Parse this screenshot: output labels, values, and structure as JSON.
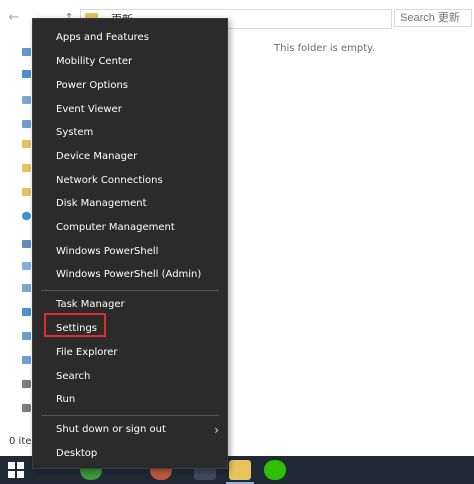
{
  "explorer": {
    "address_text": "更新",
    "search_placeholder": "Search 更新",
    "empty_message": "This folder is empty.",
    "status": "0 iter"
  },
  "menu": {
    "items": [
      {
        "label": "Apps and Features"
      },
      {
        "label": "Mobility Center"
      },
      {
        "label": "Power Options"
      },
      {
        "label": "Event Viewer"
      },
      {
        "label": "System"
      },
      {
        "label": "Device Manager"
      },
      {
        "label": "Network Connections"
      },
      {
        "label": "Disk Management"
      },
      {
        "label": "Computer Management"
      },
      {
        "label": "Windows PowerShell"
      },
      {
        "label": "Windows PowerShell (Admin)"
      },
      {
        "label": "Task Manager"
      },
      {
        "label": "Settings"
      },
      {
        "label": "File Explorer"
      },
      {
        "label": "Search"
      },
      {
        "label": "Run"
      },
      {
        "label": "Shut down or sign out"
      },
      {
        "label": "Desktop"
      }
    ]
  },
  "colors": {
    "menu_bg": "#2b2b2b",
    "highlight": "#e22c2c",
    "taskbar": "#1f2a36"
  },
  "icons": {
    "start": "windows-logo-icon",
    "back": "arrow-left-icon",
    "up": "arrow-up-icon",
    "refresh": "refresh-icon",
    "submenu": "chevron-right-icon"
  }
}
